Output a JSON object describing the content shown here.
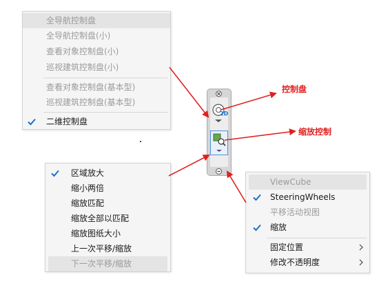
{
  "navigation_menu": {
    "items": [
      {
        "label": "全导航控制盘",
        "disabled": true,
        "highlighted": true
      },
      {
        "label": "全导航控制盘(小)",
        "disabled": true
      },
      {
        "label": "查看对象控制盘(小)",
        "disabled": true
      },
      {
        "label": "巡视建筑控制盘(小)",
        "disabled": true
      },
      {
        "label": "查看对象控制盘(基本型)",
        "disabled": true
      },
      {
        "label": "巡视建筑控制盘(基本型)",
        "disabled": true
      },
      {
        "label": "二维控制盘",
        "checked": true
      }
    ]
  },
  "zoom_menu": {
    "items": [
      {
        "label": "区域放大",
        "checked": true
      },
      {
        "label": "缩小两倍"
      },
      {
        "label": "缩放匹配"
      },
      {
        "label": "缩放全部以匹配"
      },
      {
        "label": "缩放图纸大小"
      },
      {
        "label": "上一次平移/缩放"
      },
      {
        "label": "下一次平移/缩放",
        "disabled": true,
        "highlighted": true
      }
    ]
  },
  "options_menu": {
    "items": [
      {
        "label": "ViewCube",
        "disabled": true,
        "highlighted": true
      },
      {
        "label": "SteeringWheels",
        "checked": true
      },
      {
        "label": "平移活动视图",
        "disabled": true
      },
      {
        "label": "缩放",
        "checked": true
      },
      {
        "label": "固定位置",
        "submenu": true
      },
      {
        "label": "修改不透明度",
        "submenu": true
      }
    ]
  },
  "navigation_bar": {
    "close_icon": "close-icon",
    "wheel_icon": "2d-wheel-icon",
    "zoom_icon": "zoom-region-icon",
    "badge": "2D"
  },
  "callouts": {
    "wheel": "控制盘",
    "zoom": "缩放控制"
  },
  "colors": {
    "accent": "#1a6fc9",
    "callout": "#e02020",
    "menu_bg": "#f5f5f5",
    "disabled_text": "#9a9a9a"
  }
}
